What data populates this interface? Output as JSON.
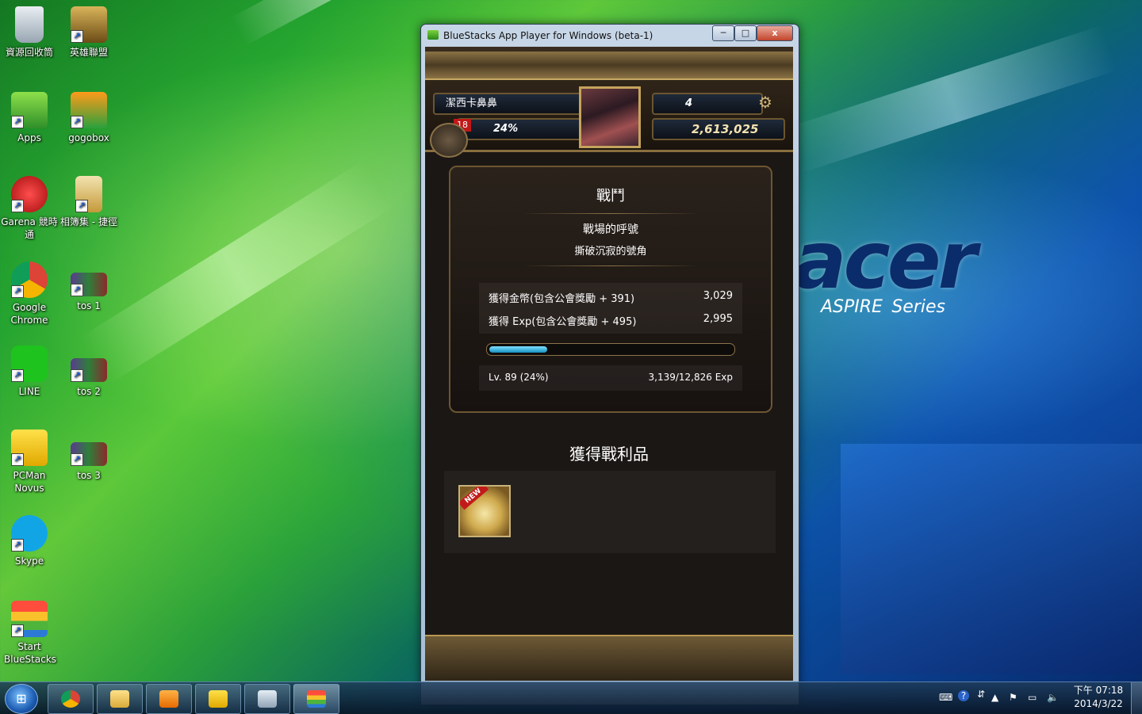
{
  "desktop": {
    "icons": [
      {
        "label": "資源回收筒"
      },
      {
        "label": "英雄聯盟"
      },
      {
        "label": "Apps"
      },
      {
        "label": "gogobox"
      },
      {
        "label": "Garena 競時通"
      },
      {
        "label": "相簿集 - 捷徑"
      },
      {
        "label": "Google Chrome"
      },
      {
        "label": "tos 1"
      },
      {
        "label": "LINE"
      },
      {
        "label": "tos 2"
      },
      {
        "label": "PCMan Novus"
      },
      {
        "label": "tos 3"
      },
      {
        "label": "Skype"
      },
      {
        "label": "Start BlueStacks"
      }
    ],
    "wallpaper": {
      "brand": "acer",
      "model": "ASPIRE",
      "series": "Series"
    }
  },
  "window": {
    "title": "BlueStacks App Player for Windows (beta-1)",
    "minimize": "─",
    "maximize": "□",
    "close": "x"
  },
  "game": {
    "player_name": "潔西卡鼻鼻",
    "level_badge": "18",
    "progress": "24%",
    "gems": "4",
    "coins": "2,613,025",
    "panel_title": "戰鬥",
    "stage_name": "戰場的呼號",
    "stage_sub": "撕破沉寂的號角",
    "rewards": [
      {
        "label": "獲得金幣(包含公會獎勵 + 391)",
        "value": "3,029"
      },
      {
        "label": "獲得 Exp(包含公會獎勵 + 495)",
        "value": "2,995"
      }
    ],
    "exp_fill": 0.24,
    "level_text": "Lv. 89 (24%)",
    "exp_text": "3,139/12,826 Exp",
    "loot_title": "獲得戰利品",
    "new_tag": "NEW"
  },
  "taskbar": {
    "start_label": "⊞",
    "apps": [
      "chrome",
      "explorer",
      "media-player",
      "pcman",
      "calculator",
      "bluestacks"
    ],
    "clock_time": "下午 07:18",
    "clock_date": "2014/3/22"
  },
  "colors": {
    "accent_gold": "#c5a35c",
    "exp_bar": "#1690c0",
    "level_badge": "#c01818"
  }
}
